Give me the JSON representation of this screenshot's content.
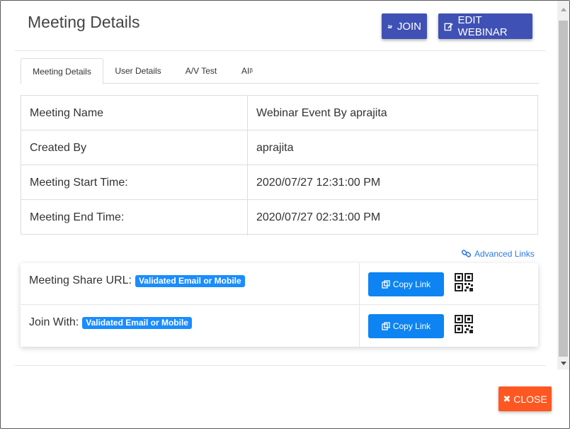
{
  "header": {
    "title": "Meeting Details",
    "join_label": "JOIN",
    "edit_label": "EDIT WEBINAR"
  },
  "tabs": [
    {
      "label": "Meeting Details",
      "active": true
    },
    {
      "label": "User Details",
      "active": false
    },
    {
      "label": "A/V Test",
      "active": false
    },
    {
      "label": "AI",
      "sup": "β",
      "active": false
    }
  ],
  "details": [
    {
      "label": "Meeting Name",
      "value": "Webinar Event By aprajita"
    },
    {
      "label": "Created By",
      "value": "aprajita"
    },
    {
      "label": "Meeting Start Time:",
      "value": "2020/07/27 12:31:00 PM"
    },
    {
      "label": "Meeting End Time:",
      "value": "2020/07/27 02:31:00 PM"
    }
  ],
  "advanced_links": "Advanced Links",
  "share": [
    {
      "label": "Meeting Share URL:",
      "badge": "Validated Email or Mobile",
      "copy_label": "Copy Link"
    },
    {
      "label": "Join With:",
      "badge": "Validated Email or Mobile",
      "copy_label": "Copy Link"
    }
  ],
  "footer": {
    "close_label": "CLOSE"
  },
  "colors": {
    "primary": "#3f51b5",
    "copy": "#0d84f2",
    "badge": "#1a8cff",
    "close": "#ff5722",
    "link": "#2a7ae2"
  }
}
